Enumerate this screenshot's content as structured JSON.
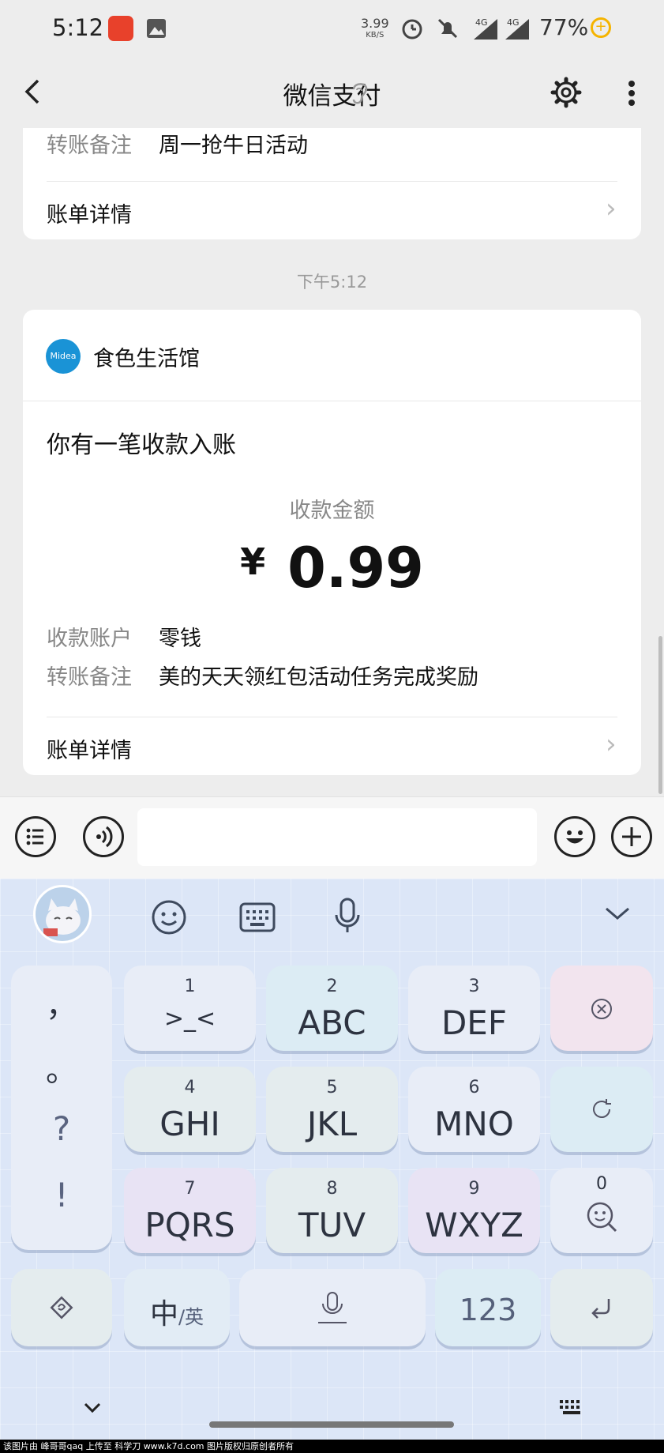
{
  "status_bar": {
    "time": "5:12",
    "net_speed_value": "3.99",
    "net_speed_unit": "KB/S",
    "net1": "4G",
    "net2": "4G",
    "battery": "77%",
    "icons": [
      "app-badge-icon",
      "gallery-icon",
      "alarm-icon",
      "mute-icon",
      "signal-icon",
      "battery-saver-icon"
    ]
  },
  "nav": {
    "title": "微信支付",
    "icons": [
      "back-icon",
      "ear-icon",
      "settings-icon",
      "more-icon"
    ]
  },
  "prev_card": {
    "remark_label": "转账备注",
    "remark_value": "周一抢牛日活动",
    "bill_details": "账单详情"
  },
  "timestamp": "下午5:12",
  "payment_card": {
    "merchant": "食色生活馆",
    "merchant_logo_text": "Midea",
    "heading": "你有一笔收款入账",
    "amount_label": "收款金额",
    "currency": "¥",
    "amount": "0.99",
    "account_label": "收款账户",
    "account_value": "零钱",
    "remark_label": "转账备注",
    "remark_value": "美的天天领红包活动任务完成奖励",
    "bill_details": "账单详情"
  },
  "input_bar": {
    "icons": [
      "menu-list-icon",
      "voice-icon",
      "emoji-icon",
      "plus-icon"
    ],
    "message_value": ""
  },
  "keyboard": {
    "toolbar_icons": [
      "avatar",
      "smiley-icon",
      "keyboard-icon",
      "microphone-icon",
      "chevron-down-icon"
    ],
    "punct_keys": [
      "，",
      "。",
      "?",
      "!"
    ],
    "keys": [
      {
        "num": "1",
        "letters": ">_<"
      },
      {
        "num": "2",
        "letters": "ABC"
      },
      {
        "num": "3",
        "letters": "DEF"
      },
      {
        "num": "4",
        "letters": "GHI"
      },
      {
        "num": "5",
        "letters": "JKL"
      },
      {
        "num": "6",
        "letters": "MNO"
      },
      {
        "num": "7",
        "letters": "PQRS"
      },
      {
        "num": "8",
        "letters": "TUV"
      },
      {
        "num": "9",
        "letters": "WXYZ"
      }
    ],
    "zero_key_num": "0",
    "lang_main": "中",
    "lang_alt": "/英",
    "num_key": "123",
    "colors": {
      "accent": "#dce6f7",
      "key_text": "#2d3340"
    }
  },
  "footer_text": "该图片由 峰哥哥qaq 上传至 科学刀 www.k7d.com 图片版权归原创者所有"
}
